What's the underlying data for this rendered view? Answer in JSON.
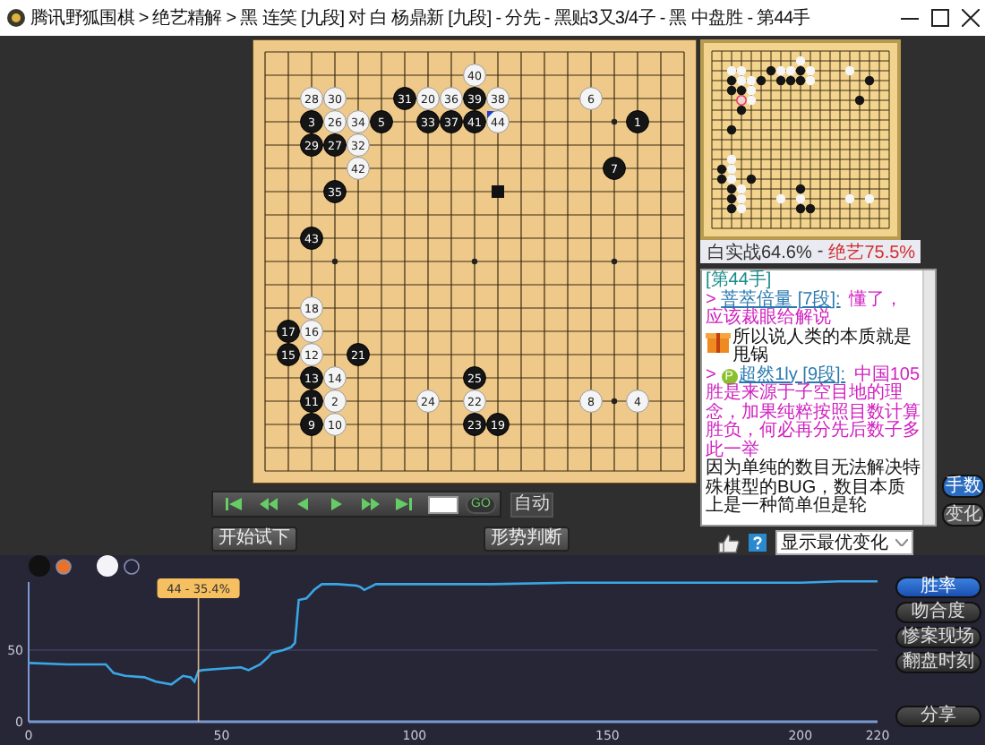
{
  "window": {
    "title": "腾讯野狐围棋 > 绝艺精解 > 黑 连笑 [九段] 对 白 杨鼎新 [九段] - 分先 - 黑贴3又3/4子 - 黑 中盘胜 - 第44手"
  },
  "board": {
    "rows": [
      {
        "cells": [
          {
            "kind": "empty"
          },
          {
            "kind": "empty"
          },
          {
            "kind": "empty"
          },
          {
            "kind": "empty"
          },
          {
            "kind": "empty"
          },
          {
            "kind": "empty"
          },
          {
            "kind": "empty"
          },
          {
            "kind": "empty"
          },
          {
            "kind": "empty"
          },
          {
            "kind": "empty"
          },
          {
            "kind": "empty"
          },
          {
            "kind": "empty"
          },
          {
            "kind": "empty"
          },
          {
            "kind": "empty"
          },
          {
            "kind": "empty"
          },
          {
            "kind": "empty"
          },
          {
            "kind": "empty"
          },
          {
            "kind": "empty"
          },
          {
            "kind": "empty"
          }
        ]
      },
      {
        "cells": [
          {
            "kind": "empty"
          },
          {
            "kind": "empty"
          },
          {
            "kind": "empty"
          },
          {
            "kind": "empty"
          },
          {
            "kind": "empty"
          },
          {
            "kind": "empty"
          },
          {
            "kind": "empty"
          },
          {
            "kind": "empty"
          },
          {
            "kind": "empty"
          },
          {
            "kind": "white",
            "n": "40",
            "last": false
          },
          {
            "kind": "empty"
          },
          {
            "kind": "empty"
          },
          {
            "kind": "empty"
          },
          {
            "kind": "empty"
          },
          {
            "kind": "empty"
          },
          {
            "kind": "empty"
          },
          {
            "kind": "empty"
          },
          {
            "kind": "empty"
          },
          {
            "kind": "empty"
          }
        ]
      },
      {
        "cells": [
          {
            "kind": "empty"
          },
          {
            "kind": "empty"
          },
          {
            "kind": "white",
            "n": "28",
            "last": false
          },
          {
            "kind": "white",
            "n": "30",
            "last": false
          },
          {
            "kind": "empty"
          },
          {
            "kind": "empty"
          },
          {
            "kind": "black",
            "n": "31",
            "last": false
          },
          {
            "kind": "white",
            "n": "20",
            "last": false
          },
          {
            "kind": "white",
            "n": "36",
            "last": false
          },
          {
            "kind": "black",
            "n": "39",
            "last": false
          },
          {
            "kind": "white",
            "n": "38",
            "last": false
          },
          {
            "kind": "empty"
          },
          {
            "kind": "empty"
          },
          {
            "kind": "empty"
          },
          {
            "kind": "white",
            "n": "6",
            "last": false
          },
          {
            "kind": "empty"
          },
          {
            "kind": "empty"
          },
          {
            "kind": "empty"
          },
          {
            "kind": "empty"
          }
        ]
      },
      {
        "cells": [
          {
            "kind": "empty"
          },
          {
            "kind": "empty"
          },
          {
            "kind": "black",
            "n": "3",
            "last": false
          },
          {
            "kind": "white",
            "n": "26",
            "last": false
          },
          {
            "kind": "white",
            "n": "34",
            "last": false
          },
          {
            "kind": "black",
            "n": "5",
            "last": false
          },
          {
            "kind": "empty"
          },
          {
            "kind": "black",
            "n": "33",
            "last": false
          },
          {
            "kind": "black",
            "n": "37",
            "last": false
          },
          {
            "kind": "black",
            "n": "41",
            "last": false
          },
          {
            "kind": "white",
            "n": "44",
            "last": true
          },
          {
            "kind": "empty"
          },
          {
            "kind": "empty"
          },
          {
            "kind": "empty"
          },
          {
            "kind": "empty"
          },
          {
            "kind": "empty"
          },
          {
            "kind": "black",
            "n": "1",
            "last": false
          },
          {
            "kind": "empty"
          },
          {
            "kind": "empty"
          }
        ]
      },
      {
        "cells": [
          {
            "kind": "empty"
          },
          {
            "kind": "empty"
          },
          {
            "kind": "black",
            "n": "29",
            "last": false
          },
          {
            "kind": "black",
            "n": "27",
            "last": false
          },
          {
            "kind": "white",
            "n": "32",
            "last": false
          },
          {
            "kind": "empty"
          },
          {
            "kind": "empty"
          },
          {
            "kind": "empty"
          },
          {
            "kind": "empty"
          },
          {
            "kind": "empty"
          },
          {
            "kind": "empty"
          },
          {
            "kind": "empty"
          },
          {
            "kind": "empty"
          },
          {
            "kind": "empty"
          },
          {
            "kind": "empty"
          },
          {
            "kind": "empty"
          },
          {
            "kind": "empty"
          },
          {
            "kind": "empty"
          },
          {
            "kind": "empty"
          }
        ]
      },
      {
        "cells": [
          {
            "kind": "empty"
          },
          {
            "kind": "empty"
          },
          {
            "kind": "empty"
          },
          {
            "kind": "hint"
          },
          {
            "kind": "white",
            "n": "42",
            "last": false
          },
          {
            "kind": "empty"
          },
          {
            "kind": "empty"
          },
          {
            "kind": "empty"
          },
          {
            "kind": "empty"
          },
          {
            "kind": "empty"
          },
          {
            "kind": "empty"
          },
          {
            "kind": "empty"
          },
          {
            "kind": "empty"
          },
          {
            "kind": "empty"
          },
          {
            "kind": "empty"
          },
          {
            "kind": "black",
            "n": "7",
            "last": false
          },
          {
            "kind": "empty"
          },
          {
            "kind": "empty"
          },
          {
            "kind": "empty"
          }
        ]
      },
      {
        "cells": [
          {
            "kind": "empty"
          },
          {
            "kind": "empty"
          },
          {
            "kind": "empty"
          },
          {
            "kind": "black",
            "n": "35",
            "last": false
          },
          {
            "kind": "empty"
          },
          {
            "kind": "empty"
          },
          {
            "kind": "empty"
          },
          {
            "kind": "empty"
          },
          {
            "kind": "empty"
          },
          {
            "kind": "empty"
          },
          {
            "kind": "square"
          },
          {
            "kind": "empty"
          },
          {
            "kind": "empty"
          },
          {
            "kind": "empty"
          },
          {
            "kind": "empty"
          },
          {
            "kind": "empty"
          },
          {
            "kind": "empty"
          },
          {
            "kind": "empty"
          },
          {
            "kind": "empty"
          }
        ]
      },
      {
        "cells": [
          {
            "kind": "empty"
          },
          {
            "kind": "empty"
          },
          {
            "kind": "empty"
          },
          {
            "kind": "empty"
          },
          {
            "kind": "empty"
          },
          {
            "kind": "empty"
          },
          {
            "kind": "empty"
          },
          {
            "kind": "empty"
          },
          {
            "kind": "empty"
          },
          {
            "kind": "empty"
          },
          {
            "kind": "empty"
          },
          {
            "kind": "empty"
          },
          {
            "kind": "empty"
          },
          {
            "kind": "empty"
          },
          {
            "kind": "empty"
          },
          {
            "kind": "empty"
          },
          {
            "kind": "empty"
          },
          {
            "kind": "empty"
          },
          {
            "kind": "empty"
          }
        ]
      },
      {
        "cells": [
          {
            "kind": "empty"
          },
          {
            "kind": "empty"
          },
          {
            "kind": "black",
            "n": "43",
            "last": false
          },
          {
            "kind": "empty"
          },
          {
            "kind": "empty"
          },
          {
            "kind": "empty"
          },
          {
            "kind": "empty"
          },
          {
            "kind": "empty"
          },
          {
            "kind": "empty"
          },
          {
            "kind": "empty"
          },
          {
            "kind": "empty"
          },
          {
            "kind": "empty"
          },
          {
            "kind": "empty"
          },
          {
            "kind": "empty"
          },
          {
            "kind": "empty"
          },
          {
            "kind": "empty"
          },
          {
            "kind": "empty"
          },
          {
            "kind": "empty"
          },
          {
            "kind": "empty"
          }
        ]
      },
      {
        "cells": [
          {
            "kind": "empty"
          },
          {
            "kind": "empty"
          },
          {
            "kind": "empty"
          },
          {
            "kind": "empty"
          },
          {
            "kind": "empty"
          },
          {
            "kind": "empty"
          },
          {
            "kind": "empty"
          },
          {
            "kind": "empty"
          },
          {
            "kind": "empty"
          },
          {
            "kind": "empty"
          },
          {
            "kind": "empty"
          },
          {
            "kind": "empty"
          },
          {
            "kind": "empty"
          },
          {
            "kind": "empty"
          },
          {
            "kind": "empty"
          },
          {
            "kind": "empty"
          },
          {
            "kind": "empty"
          },
          {
            "kind": "empty"
          },
          {
            "kind": "empty"
          }
        ]
      },
      {
        "cells": [
          {
            "kind": "empty"
          },
          {
            "kind": "empty"
          },
          {
            "kind": "empty"
          },
          {
            "kind": "empty"
          },
          {
            "kind": "empty"
          },
          {
            "kind": "empty"
          },
          {
            "kind": "empty"
          },
          {
            "kind": "empty"
          },
          {
            "kind": "empty"
          },
          {
            "kind": "empty"
          },
          {
            "kind": "empty"
          },
          {
            "kind": "empty"
          },
          {
            "kind": "empty"
          },
          {
            "kind": "empty"
          },
          {
            "kind": "empty"
          },
          {
            "kind": "empty"
          },
          {
            "kind": "empty"
          },
          {
            "kind": "empty"
          },
          {
            "kind": "empty"
          }
        ]
      },
      {
        "cells": [
          {
            "kind": "empty"
          },
          {
            "kind": "empty"
          },
          {
            "kind": "white",
            "n": "18",
            "last": false
          },
          {
            "kind": "empty"
          },
          {
            "kind": "empty"
          },
          {
            "kind": "empty"
          },
          {
            "kind": "empty"
          },
          {
            "kind": "empty"
          },
          {
            "kind": "empty"
          },
          {
            "kind": "empty"
          },
          {
            "kind": "empty"
          },
          {
            "kind": "empty"
          },
          {
            "kind": "empty"
          },
          {
            "kind": "empty"
          },
          {
            "kind": "empty"
          },
          {
            "kind": "empty"
          },
          {
            "kind": "empty"
          },
          {
            "kind": "empty"
          },
          {
            "kind": "empty"
          }
        ]
      },
      {
        "cells": [
          {
            "kind": "empty"
          },
          {
            "kind": "black",
            "n": "17",
            "last": false
          },
          {
            "kind": "white",
            "n": "16",
            "last": false
          },
          {
            "kind": "empty"
          },
          {
            "kind": "empty"
          },
          {
            "kind": "empty"
          },
          {
            "kind": "empty"
          },
          {
            "kind": "empty"
          },
          {
            "kind": "empty"
          },
          {
            "kind": "empty"
          },
          {
            "kind": "empty"
          },
          {
            "kind": "empty"
          },
          {
            "kind": "empty"
          },
          {
            "kind": "empty"
          },
          {
            "kind": "empty"
          },
          {
            "kind": "empty"
          },
          {
            "kind": "empty"
          },
          {
            "kind": "empty"
          },
          {
            "kind": "empty"
          }
        ]
      },
      {
        "cells": [
          {
            "kind": "empty"
          },
          {
            "kind": "black",
            "n": "15",
            "last": false
          },
          {
            "kind": "white",
            "n": "12",
            "last": false
          },
          {
            "kind": "empty"
          },
          {
            "kind": "black",
            "n": "21",
            "last": false
          },
          {
            "kind": "empty"
          },
          {
            "kind": "empty"
          },
          {
            "kind": "empty"
          },
          {
            "kind": "empty"
          },
          {
            "kind": "empty"
          },
          {
            "kind": "empty"
          },
          {
            "kind": "empty"
          },
          {
            "kind": "empty"
          },
          {
            "kind": "empty"
          },
          {
            "kind": "empty"
          },
          {
            "kind": "empty"
          },
          {
            "kind": "empty"
          },
          {
            "kind": "empty"
          },
          {
            "kind": "empty"
          }
        ]
      },
      {
        "cells": [
          {
            "kind": "empty"
          },
          {
            "kind": "empty"
          },
          {
            "kind": "black",
            "n": "13",
            "last": false
          },
          {
            "kind": "white",
            "n": "14",
            "last": false
          },
          {
            "kind": "empty"
          },
          {
            "kind": "empty"
          },
          {
            "kind": "empty"
          },
          {
            "kind": "empty"
          },
          {
            "kind": "empty"
          },
          {
            "kind": "black",
            "n": "25",
            "last": false
          },
          {
            "kind": "empty"
          },
          {
            "kind": "empty"
          },
          {
            "kind": "empty"
          },
          {
            "kind": "empty"
          },
          {
            "kind": "empty"
          },
          {
            "kind": "empty"
          },
          {
            "kind": "empty"
          },
          {
            "kind": "empty"
          },
          {
            "kind": "empty"
          }
        ]
      },
      {
        "cells": [
          {
            "kind": "empty"
          },
          {
            "kind": "empty"
          },
          {
            "kind": "black",
            "n": "11",
            "last": false
          },
          {
            "kind": "white",
            "n": "2",
            "last": false
          },
          {
            "kind": "empty"
          },
          {
            "kind": "empty"
          },
          {
            "kind": "empty"
          },
          {
            "kind": "white",
            "n": "24",
            "last": false
          },
          {
            "kind": "empty"
          },
          {
            "kind": "white",
            "n": "22",
            "last": false
          },
          {
            "kind": "empty"
          },
          {
            "kind": "empty"
          },
          {
            "kind": "empty"
          },
          {
            "kind": "empty"
          },
          {
            "kind": "white",
            "n": "8",
            "last": false
          },
          {
            "kind": "empty"
          },
          {
            "kind": "white",
            "n": "4",
            "last": false
          },
          {
            "kind": "empty"
          },
          {
            "kind": "empty"
          }
        ]
      },
      {
        "cells": [
          {
            "kind": "empty"
          },
          {
            "kind": "empty"
          },
          {
            "kind": "black",
            "n": "9",
            "last": false
          },
          {
            "kind": "white",
            "n": "10",
            "last": false
          },
          {
            "kind": "empty"
          },
          {
            "kind": "empty"
          },
          {
            "kind": "empty"
          },
          {
            "kind": "empty"
          },
          {
            "kind": "empty"
          },
          {
            "kind": "black",
            "n": "23",
            "last": false
          },
          {
            "kind": "black",
            "n": "19",
            "last": false
          },
          {
            "kind": "empty"
          },
          {
            "kind": "empty"
          },
          {
            "kind": "empty"
          },
          {
            "kind": "empty"
          },
          {
            "kind": "empty"
          },
          {
            "kind": "empty"
          },
          {
            "kind": "empty"
          },
          {
            "kind": "empty"
          }
        ]
      },
      {
        "cells": [
          {
            "kind": "empty"
          },
          {
            "kind": "empty"
          },
          {
            "kind": "empty"
          },
          {
            "kind": "empty"
          },
          {
            "kind": "empty"
          },
          {
            "kind": "empty"
          },
          {
            "kind": "empty"
          },
          {
            "kind": "empty"
          },
          {
            "kind": "empty"
          },
          {
            "kind": "empty"
          },
          {
            "kind": "empty"
          },
          {
            "kind": "empty"
          },
          {
            "kind": "empty"
          },
          {
            "kind": "empty"
          },
          {
            "kind": "empty"
          },
          {
            "kind": "empty"
          },
          {
            "kind": "empty"
          },
          {
            "kind": "empty"
          },
          {
            "kind": "empty"
          }
        ]
      },
      {
        "cells": [
          {
            "kind": "empty"
          },
          {
            "kind": "empty"
          },
          {
            "kind": "empty"
          },
          {
            "kind": "empty"
          },
          {
            "kind": "empty"
          },
          {
            "kind": "empty"
          },
          {
            "kind": "empty"
          },
          {
            "kind": "empty"
          },
          {
            "kind": "empty"
          },
          {
            "kind": "empty"
          },
          {
            "kind": "empty"
          },
          {
            "kind": "empty"
          },
          {
            "kind": "empty"
          },
          {
            "kind": "empty"
          },
          {
            "kind": "empty"
          },
          {
            "kind": "empty"
          },
          {
            "kind": "empty"
          },
          {
            "kind": "empty"
          },
          {
            "kind": "empty"
          }
        ]
      }
    ]
  },
  "win_rate": {
    "actual": "白实战64.6%",
    "separator": "-",
    "ai": "绝艺75.5%"
  },
  "chat": {
    "messages": [
      {
        "kind": "move",
        "text": "[第44手]"
      },
      {
        "kind": "user",
        "prefix": ">",
        "name": "菩萃倍量 [7段]:",
        "message": "懂了，应该裁眼给解说"
      },
      {
        "kind": "emote",
        "text": "所以说人类的本质就是甩锅"
      },
      {
        "kind": "user",
        "prefix": ">",
        "badge": "P",
        "name": "超然1ly [9段]:",
        "message": "中国105胜是来源于子空目地的理念，加果纯粹按照目数计算胜负，何必再分先后数子多此一举"
      },
      {
        "kind": "plain",
        "text": "因为单纯的数目无法解决特殊棋型的BUG，数目本质上是一种简单但是轮"
      }
    ]
  },
  "chat_buttons": [
    {
      "label": "手数",
      "selected": true
    },
    {
      "label": "变化",
      "selected": false
    }
  ],
  "playback": {
    "go": "GO",
    "auto": "自动"
  },
  "actions": [
    "开始试下",
    "形势判断"
  ],
  "variation_select": {
    "value": "显示最优变化"
  },
  "chart": {
    "toggles": [
      {
        "kind": "black",
        "selected": true
      },
      {
        "kind": "white",
        "selected": false
      }
    ],
    "chart_data": {
      "type": "line",
      "x": [
        0,
        10,
        20,
        22,
        25,
        30,
        33,
        37,
        40,
        42,
        43,
        44,
        45,
        50,
        55,
        57,
        60,
        62,
        63,
        66,
        68,
        69,
        70,
        72,
        74,
        76,
        80,
        85,
        86,
        87,
        90,
        95,
        100,
        110,
        120,
        140,
        160,
        180,
        200,
        210,
        220
      ],
      "series": [
        {
          "color": "#3aa6e6",
          "values": [
            41,
            40,
            40,
            34,
            32,
            31,
            28,
            26,
            32,
            31,
            28,
            35.4,
            36,
            37,
            38,
            36,
            40,
            45,
            48,
            50,
            52,
            55,
            85,
            86,
            92,
            96,
            96,
            95,
            94,
            92,
            96,
            96,
            96,
            96,
            96,
            97,
            97,
            97,
            97,
            98,
            98
          ]
        }
      ],
      "xlim": [
        0,
        220
      ],
      "ylim": [
        0,
        100
      ],
      "xticks": [
        0,
        50,
        100,
        150,
        200,
        220
      ],
      "yticks": [
        0,
        50
      ],
      "ref_lines": [
        {
          "axis": "x",
          "value": 44
        }
      ],
      "annotations": [
        "44 - 35.4%"
      ]
    },
    "tabs": [
      {
        "label": "胜率",
        "selected": true
      },
      {
        "label": "吻合度",
        "selected": false
      },
      {
        "label": "惨案现场",
        "selected": false
      },
      {
        "label": "翻盘时刻",
        "selected": false
      }
    ],
    "share": "分享"
  }
}
